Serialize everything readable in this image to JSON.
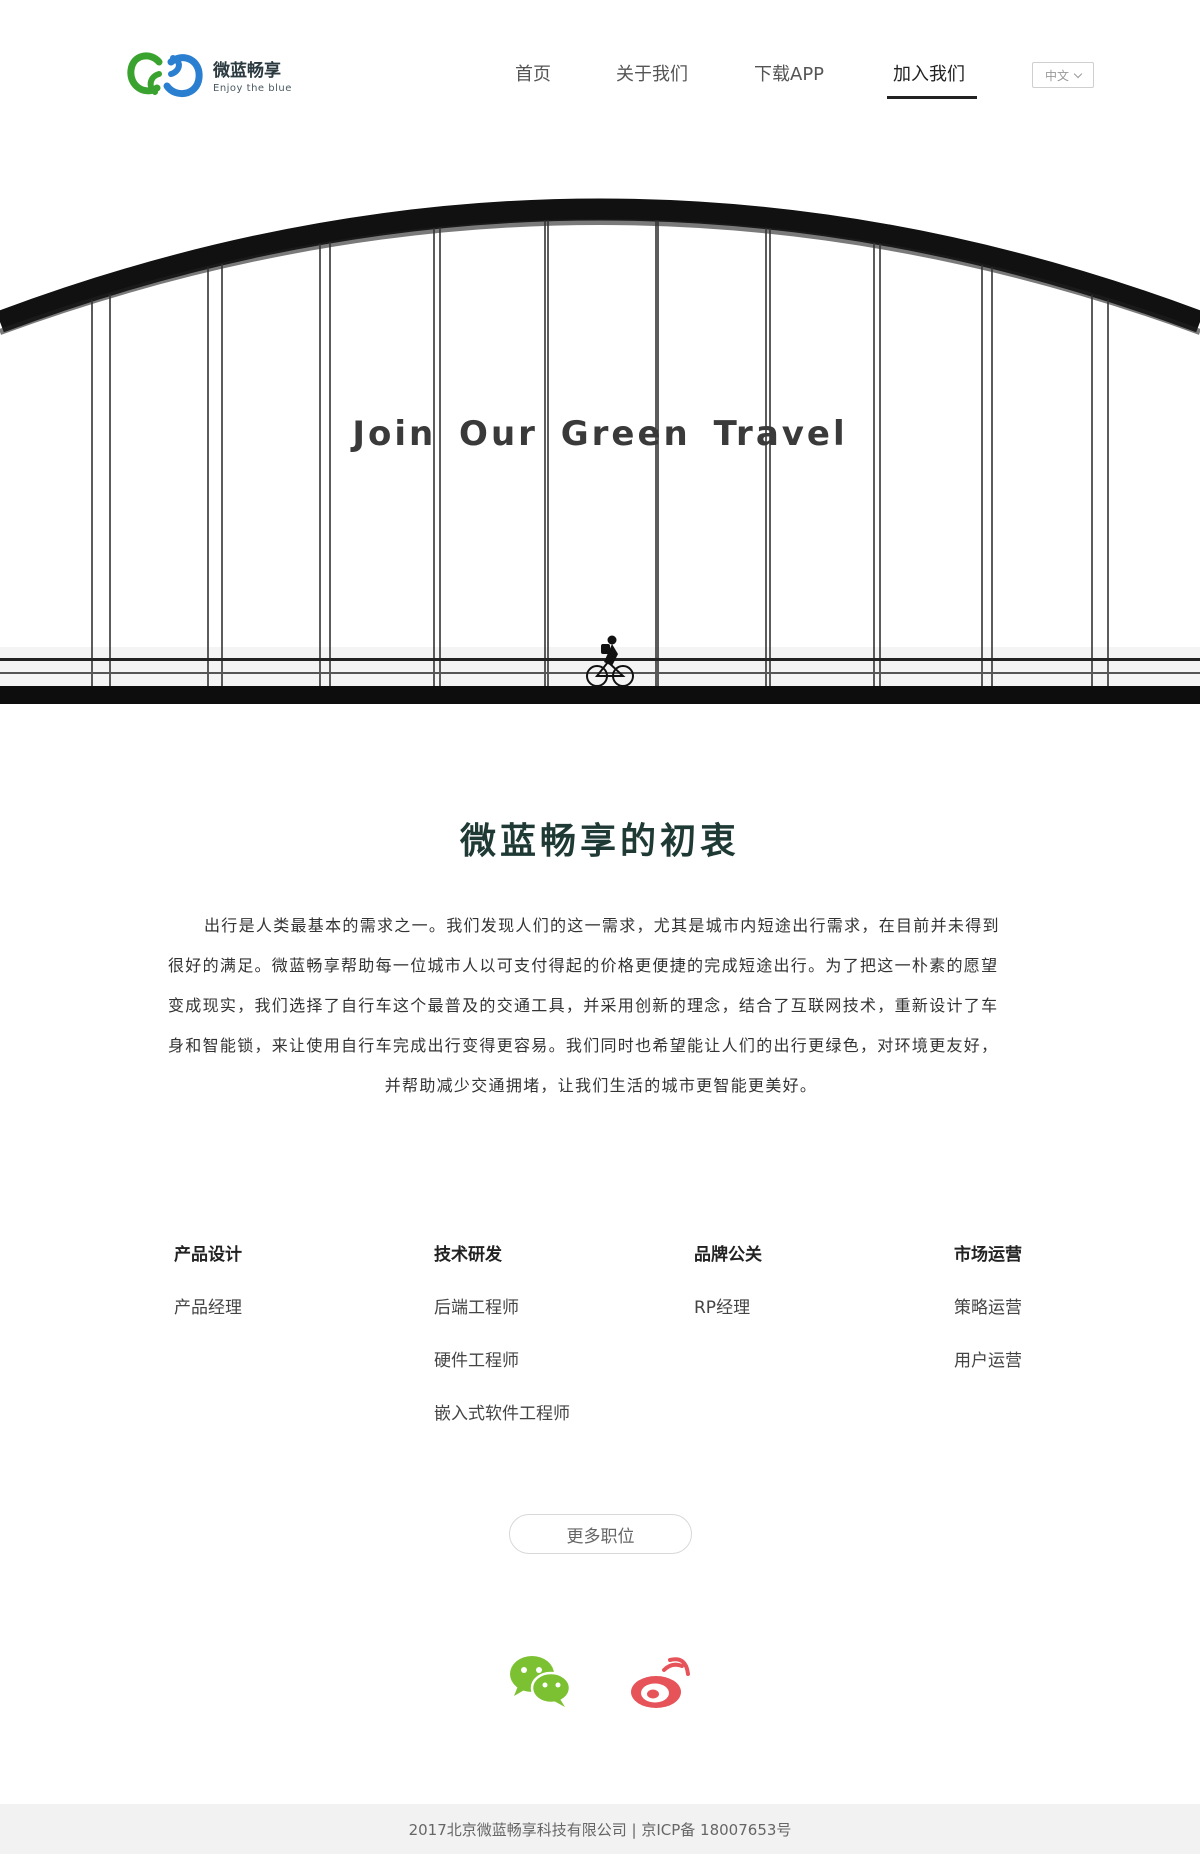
{
  "header": {
    "logo": {
      "name_cn": "微蓝畅享",
      "tagline": "Enjoy the blue",
      "colors": {
        "green": "#3aa32f",
        "blue": "#2a7fd0"
      }
    },
    "nav": [
      {
        "label": "首页",
        "active": false
      },
      {
        "label": "关于我们",
        "active": false
      },
      {
        "label": "下载APP",
        "active": false
      },
      {
        "label": "加入我们",
        "active": true
      }
    ],
    "language": {
      "selected": "中文"
    }
  },
  "hero": {
    "title": "Join Our Green Travel"
  },
  "intro": {
    "title": "微蓝畅享的初衷",
    "lines": [
      "出行是人类最基本的需求之一。我们发现人们的这一需求，尤其是城市内短途出行需求，在目前并未得到",
      "很好的满足。微蓝畅享帮助每一位城市人以可支付得起的价格更便捷的完成短途出行。为了把这一朴素的愿望",
      "变成现实，我们选择了自行车这个最普及的交通工具，并采用创新的理念，结合了互联网技术，重新设计了车",
      "身和智能锁，来让使用自行车完成出行变得更容易。我们同时也希望能让人们的出行更绿色，对环境更友好，",
      "并帮助减少交通拥堵，让我们生活的城市更智能更美好。"
    ]
  },
  "jobs": [
    {
      "category": "产品设计",
      "positions": [
        "产品经理"
      ]
    },
    {
      "category": "技术研发",
      "positions": [
        "后端工程师",
        "硬件工程师",
        "嵌入式软件工程师"
      ]
    },
    {
      "category": "品牌公关",
      "positions": [
        "RP经理"
      ]
    },
    {
      "category": "市场运营",
      "positions": [
        "策略运营",
        "用户运营"
      ]
    }
  ],
  "more_button": "更多职位",
  "social": {
    "wechat_color": "#7bc132",
    "weibo_color": "#e6545a"
  },
  "footer": {
    "text": "2017北京微蓝畅享科技有限公司 | 京ICP备 18007653号"
  }
}
